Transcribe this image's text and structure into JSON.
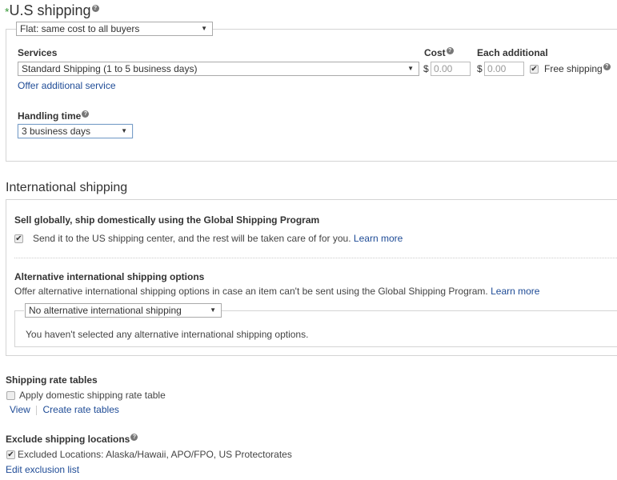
{
  "us_shipping": {
    "required_mark": "*",
    "title": "U.S shipping",
    "type_select": "Flat: same cost to all buyers",
    "services_label": "Services",
    "service_select": "Standard Shipping (1 to 5 business days)",
    "offer_additional": "Offer additional service",
    "cost_label": "Cost",
    "each_additional_label": "Each additional",
    "currency": "$",
    "cost_value": "0.00",
    "each_additional_value": "0.00",
    "free_shipping_label": "Free shipping",
    "free_shipping_checked": true,
    "handling_label": "Handling time",
    "handling_select": "3 business days"
  },
  "international": {
    "title": "International shipping",
    "gsp_heading": "Sell globally, ship domestically using the Global Shipping Program",
    "gsp_checkbox_label": "Send it to the US shipping center, and the rest will be taken care of for you.",
    "gsp_checked": true,
    "learn_more": "Learn more",
    "alt_heading": "Alternative international shipping options",
    "alt_desc": "Offer alternative international shipping options in case an item can't be sent using the Global Shipping Program.",
    "alt_learn_more": "Learn more",
    "alt_select": "No alternative international shipping",
    "alt_empty": "You haven't selected any alternative international shipping options."
  },
  "rate_tables": {
    "heading": "Shipping rate tables",
    "apply_label": "Apply domestic shipping rate table",
    "apply_checked": false,
    "view_link": "View",
    "create_link": "Create rate tables"
  },
  "exclude": {
    "heading": "Exclude shipping locations",
    "excluded_label": "Excluded Locations: Alaska/Hawaii, APO/FPO, US Protectorates",
    "excluded_checked": true,
    "edit_link": "Edit exclusion list"
  },
  "icons": {
    "help": "?",
    "dropdown": "▼",
    "check": "✔"
  }
}
